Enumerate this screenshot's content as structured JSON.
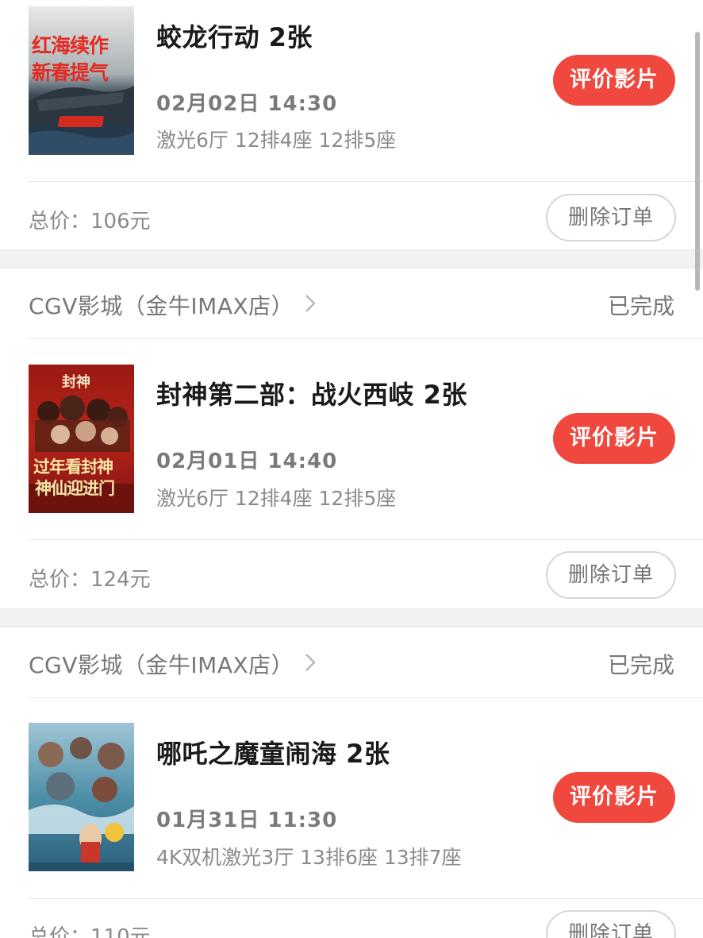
{
  "orders": [
    {
      "movie_title": "蛟龙行动 2张",
      "showtime": "02月02日 14:30",
      "seats": "激光6厅 12排4座 12排5座",
      "review_label": "评价影片",
      "total_price": "总价：106元",
      "delete_label": "删除订单",
      "poster_icon": "poster-jiaolong",
      "poster_text": [
        "红海续作",
        "新春提气"
      ]
    },
    {
      "cinema_name": "CGV影城（金牛IMAX店）",
      "status": "已完成",
      "movie_title": "封神第二部：战火西岐 2张",
      "showtime": "02月01日 14:40",
      "seats": "激光6厅 12排4座 12排5座",
      "review_label": "评价影片",
      "total_price": "总价：124元",
      "delete_label": "删除订单",
      "poster_icon": "poster-fengshen",
      "poster_text": [
        "封神",
        "过年看封神",
        "神仙迎进门"
      ]
    },
    {
      "cinema_name": "CGV影城（金牛IMAX店）",
      "status": "已完成",
      "movie_title": "哪吒之魔童闹海 2张",
      "showtime": "01月31日 11:30",
      "seats": "4K双机激光3厅 13排6座 13排7座",
      "review_label": "评价影片",
      "total_price": "总价：110元",
      "delete_label": "删除订单",
      "poster_icon": "poster-nezha"
    }
  ],
  "colors": {
    "accent": "#f0483e",
    "section_gap": "#f2f2f2",
    "secondary_text": "#777777"
  }
}
